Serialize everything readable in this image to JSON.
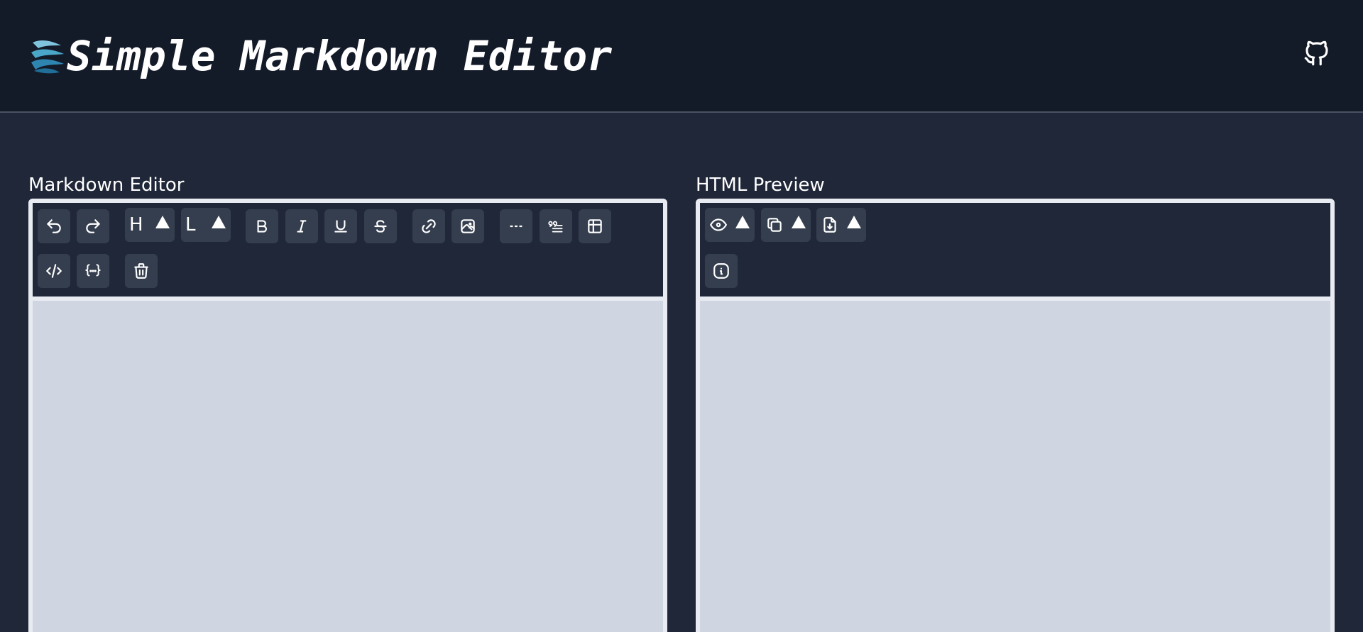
{
  "header": {
    "title": "Simple Markdown Editor",
    "logo_icon": "swirl-logo-icon",
    "github_icon": "github-icon"
  },
  "editor": {
    "label": "Markdown Editor",
    "toolbar": {
      "undo_icon": "undo-icon",
      "redo_icon": "redo-icon",
      "heading_letter": "H",
      "list_letter": "L",
      "bold_letter": "B",
      "italic_letter": "I",
      "underline_letter": "U",
      "strikethrough_letter": "S"
    },
    "content": ""
  },
  "preview": {
    "label": "HTML Preview",
    "content": ""
  },
  "colors": {
    "header_bg": "#131a28",
    "page_bg": "#1f2738",
    "button_bg": "#353e4e",
    "panel_border": "#e8ebf1",
    "editor_bg": "#d0d6e1"
  }
}
